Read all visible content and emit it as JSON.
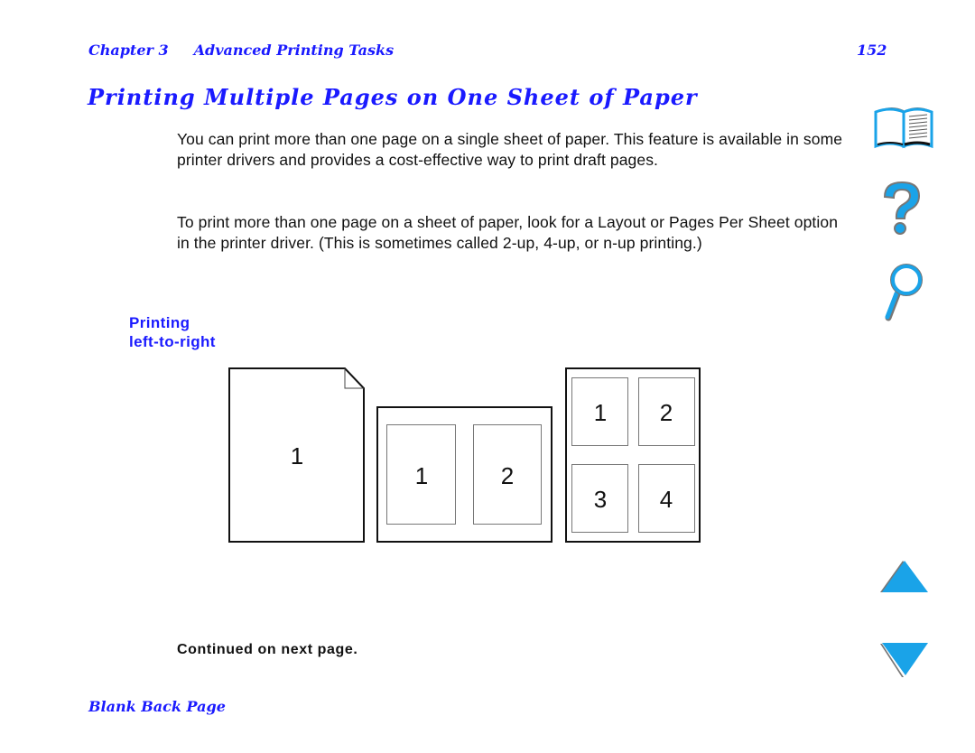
{
  "header": {
    "chapter": "Chapter 3",
    "section": "Advanced Printing Tasks",
    "page_number": "152"
  },
  "title": "Printing Multiple Pages on One Sheet of Paper",
  "body": {
    "paragraph1": "You can print more than one page on a single sheet of paper. This feature is available in some printer drivers and provides a cost-effective way to print draft pages.",
    "paragraph2": "To print more than one page on a sheet of paper, look for a Layout or Pages Per Sheet option in the printer driver. (This is sometimes called 2-up, 4-up, or n-up printing.)"
  },
  "side_heading": {
    "line1": "Printing",
    "line2": "left-to-right"
  },
  "figure": {
    "single_page": {
      "labels": [
        "1"
      ]
    },
    "two_up": {
      "labels": [
        "1",
        "2"
      ]
    },
    "four_up": {
      "labels": [
        "1",
        "2",
        "3",
        "4"
      ]
    }
  },
  "continued": "Continued on next page.",
  "footer": {
    "link": "Blank Back Page"
  },
  "nav_icons": [
    "book-contents-icon",
    "help-question-icon",
    "search-magnifier-icon",
    "previous-page-arrow-icon",
    "next-page-arrow-icon"
  ],
  "colors": {
    "heading_blue": "#1a1aff",
    "icon_blue": "#1aa3e8",
    "icon_shadow": "#707070"
  }
}
